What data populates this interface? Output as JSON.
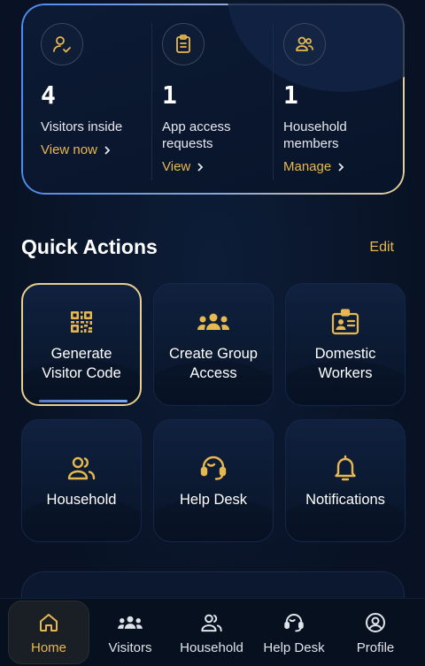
{
  "summary": {
    "stats": [
      {
        "icon": "user-check-icon",
        "value": "4",
        "label": "Visitors inside",
        "link": "View now"
      },
      {
        "icon": "clipboard-icon",
        "value": "1",
        "label": "App access requests",
        "link": "View"
      },
      {
        "icon": "users-icon",
        "value": "1",
        "label": "Household members",
        "link": "Manage"
      }
    ]
  },
  "quick_actions": {
    "title": "Quick Actions",
    "edit_label": "Edit",
    "tiles": [
      {
        "icon": "qr-code-icon",
        "label": "Generate Visitor Code"
      },
      {
        "icon": "group-icon",
        "label": "Create Group Access"
      },
      {
        "icon": "id-badge-icon",
        "label": "Domestic Workers"
      },
      {
        "icon": "household-icon",
        "label": "Household"
      },
      {
        "icon": "headset-icon",
        "label": "Help Desk"
      },
      {
        "icon": "bell-icon",
        "label": "Notifications"
      }
    ]
  },
  "nav": {
    "items": [
      {
        "icon": "home-icon",
        "label": "Home"
      },
      {
        "icon": "visitors-icon",
        "label": "Visitors"
      },
      {
        "icon": "household-icon",
        "label": "Household"
      },
      {
        "icon": "headset-icon",
        "label": "Help Desk"
      },
      {
        "icon": "profile-icon",
        "label": "Profile"
      }
    ]
  },
  "colors": {
    "accent": "#e7b84f",
    "background": "#081224"
  }
}
